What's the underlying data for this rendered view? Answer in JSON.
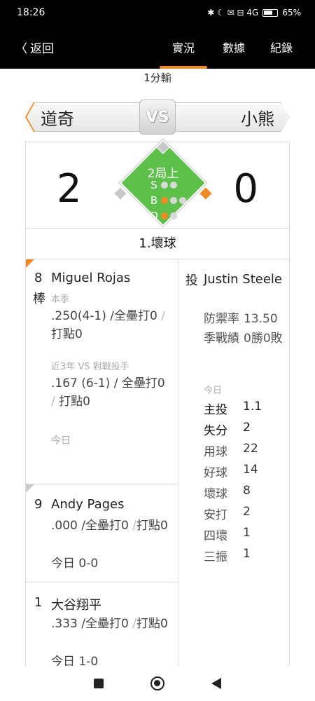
{
  "status_bar": {
    "time": "18:26",
    "icons": "✱ ☾ ✉ ⊟ 4G",
    "battery_text": "65%"
  },
  "nav": {
    "back_label": "返回",
    "tabs": [
      {
        "label": "實況",
        "active": true
      },
      {
        "label": "數據",
        "active": false
      },
      {
        "label": "紀錄",
        "active": false
      }
    ]
  },
  "game_status": "1分輸",
  "teams": {
    "away": "道奇",
    "home": "小熊",
    "vs": "VS"
  },
  "score": {
    "away": "2",
    "home": "0"
  },
  "situation": {
    "inning": "2局上",
    "labels": {
      "s": "S",
      "b": "B",
      "o": "O"
    },
    "strikes": 0,
    "balls": 1,
    "outs": 1,
    "bases": {
      "first": true,
      "second": false,
      "third": false
    }
  },
  "pitch_result": "1.壞球",
  "current_batter": {
    "order": "8",
    "order_suffix": "棒",
    "name": "Miguel Rojas",
    "season_label": "本季",
    "season_avg": ".250(4-1)",
    "season_hr": "/全壘打0",
    "season_rbi": "打點0",
    "vs_label": "近3年 VS 對戰投手",
    "vs_avg": ".167 (6-1)",
    "vs_hr": "/ 全壘打0",
    "vs_rbi": "打點0",
    "today_label": "今日"
  },
  "next_batters": [
    {
      "order": "9",
      "name": "Andy Pages",
      "avg": ".000",
      "hr": "/全壘打0",
      "rbi": "打點0",
      "today": "今日 0-0"
    },
    {
      "order": "1",
      "name": "大谷翔平",
      "avg": ".333",
      "hr": "/全壘打0",
      "rbi": "打點0",
      "today": "今日 1-0"
    }
  ],
  "pitcher": {
    "role": "投",
    "name": "Justin Steele",
    "era_label": "防禦率",
    "era": "13.50",
    "record_label": "季戰績",
    "record": "0勝0敗",
    "today_label": "今日",
    "line": [
      {
        "k": "主投",
        "v": "1.1",
        "strong": true
      },
      {
        "k": "失分",
        "v": "2",
        "strong": true
      },
      {
        "k": "用球",
        "v": "22",
        "strong": false
      },
      {
        "k": "好球",
        "v": "14",
        "strong": false
      },
      {
        "k": "壞球",
        "v": "8",
        "strong": false
      },
      {
        "k": "安打",
        "v": "2",
        "strong": false
      },
      {
        "k": "四壞",
        "v": "1",
        "strong": false
      },
      {
        "k": "三振",
        "v": "1",
        "strong": false
      }
    ]
  },
  "colors": {
    "accent": "#f08a24",
    "field": "#5cc04a"
  }
}
